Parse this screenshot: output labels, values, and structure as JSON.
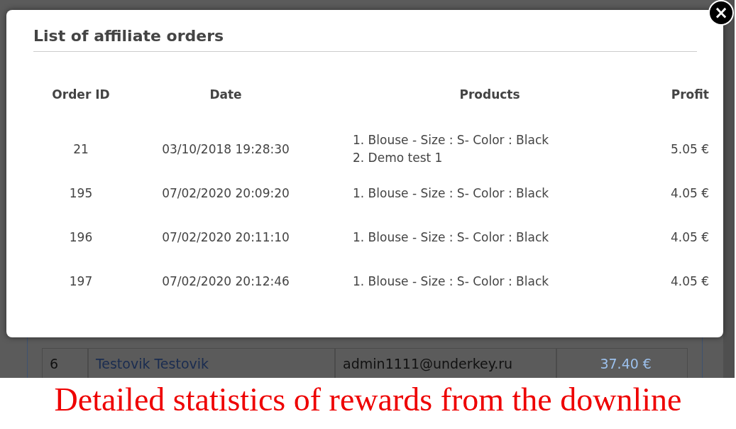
{
  "background_table": {
    "rows": [
      {
        "cells": [
          {
            "kind": "text",
            "text": "6"
          },
          {
            "kind": "link",
            "text": "Testovik Testovik"
          },
          {
            "kind": "text",
            "text": "admin1111@underkey.ru"
          },
          {
            "kind": "amount",
            "text": "37.40 €"
          }
        ]
      }
    ]
  },
  "modal": {
    "title": "List of affiliate orders",
    "close": "×",
    "columns": [
      "Order ID",
      "Date",
      "Products",
      "Profit"
    ],
    "rows": [
      {
        "order_id": "21",
        "date": "03/10/2018 19:28:30",
        "products": [
          "1. Blouse - Size : S- Color : Black",
          "2. Demo test 1"
        ],
        "profit": "5.05 €"
      },
      {
        "order_id": "195",
        "date": "07/02/2020 20:09:20",
        "products": [
          "1. Blouse - Size : S- Color : Black"
        ],
        "profit": "4.05 €"
      },
      {
        "order_id": "196",
        "date": "07/02/2020 20:11:10",
        "products": [
          "1. Blouse - Size : S- Color : Black"
        ],
        "profit": "4.05 €"
      },
      {
        "order_id": "197",
        "date": "07/02/2020 20:12:46",
        "products": [
          "1. Blouse - Size : S- Color : Black"
        ],
        "profit": "4.05 €"
      }
    ]
  },
  "caption": "Detailed statistics of rewards from the downline"
}
